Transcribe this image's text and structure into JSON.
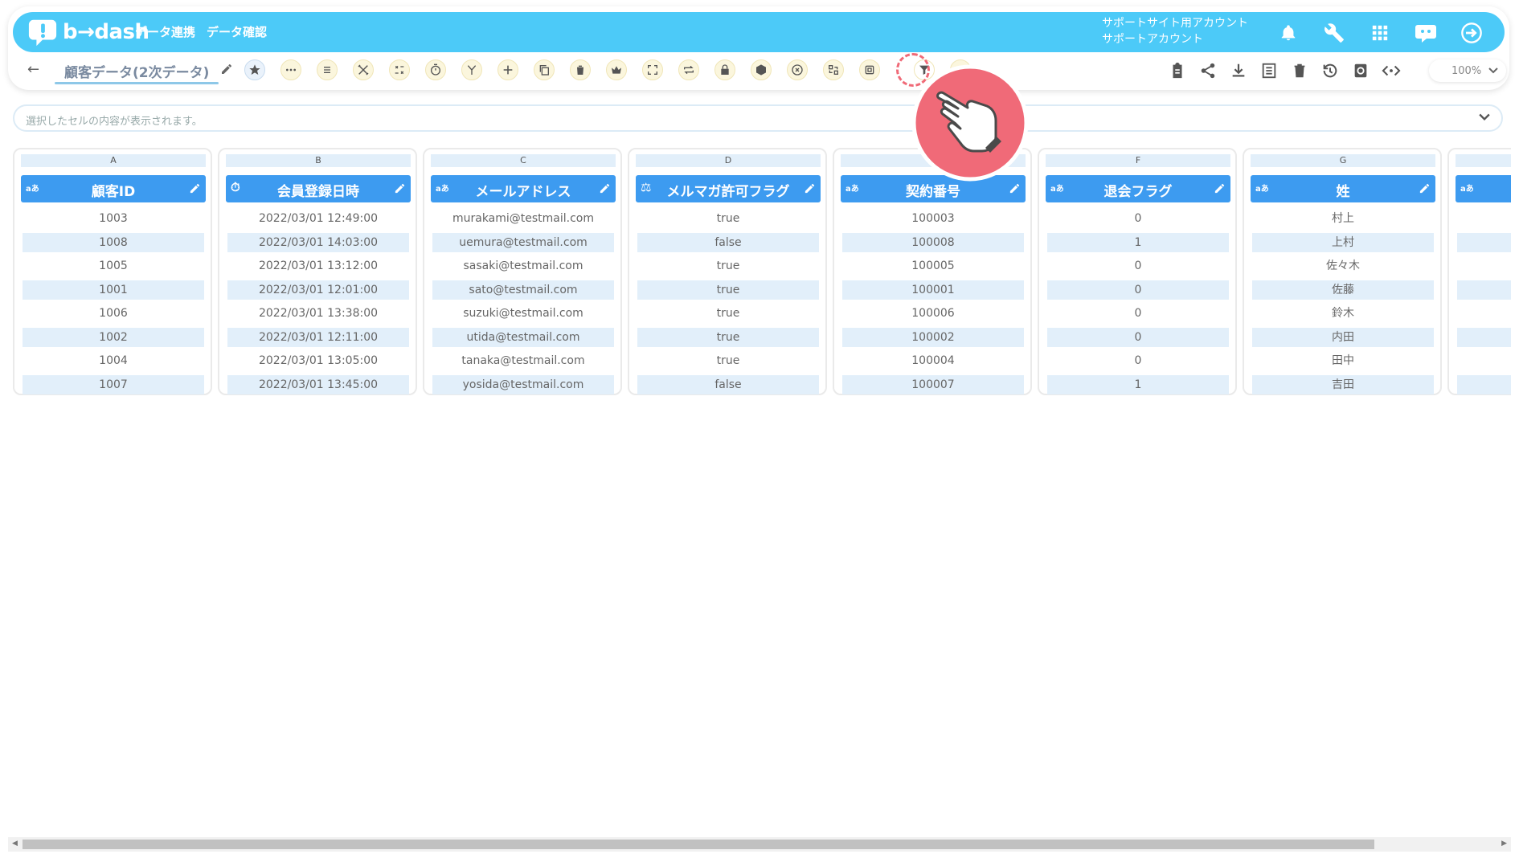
{
  "app": {
    "brand": "b→dash",
    "colors": {
      "nav": "#4ccaf8",
      "header": "#3d9bf0",
      "alt_row": "#e2effa",
      "accent": "#f06a78"
    }
  },
  "nav": {
    "links": [
      "データ連携",
      "データ確認"
    ],
    "account_line1": "サポートサイト用アカウント",
    "account_line2": "サポートアカウント",
    "icons": [
      "bell-icon",
      "wrench-icon",
      "apps-grid-icon",
      "support-chat-icon",
      "logout-icon"
    ]
  },
  "toolbar": {
    "title": "顧客データ(2次データ)",
    "zoom": "100%",
    "tool_icons": [
      "star-icon",
      "more-icon",
      "list-icon",
      "tools-icon",
      "transform-icon",
      "timer-icon",
      "branch-icon",
      "add-icon",
      "copy-icon",
      "delete-icon",
      "crown-icon",
      "expand-icon",
      "repeat-icon",
      "lock-icon",
      "package-icon",
      "close-circle-icon",
      "swap-icon",
      "frame-icon",
      "filter-icon",
      "more-tools-icon"
    ],
    "right_icons": [
      "clipboard-icon",
      "share-icon",
      "download-icon",
      "sheet-icon",
      "trash-icon",
      "history-icon",
      "refresh-icon",
      "code-icon"
    ]
  },
  "formula_bar": {
    "placeholder": "選択したセルの内容が表示されます。"
  },
  "table": {
    "columns": [
      {
        "letter": "A",
        "type": "aあ",
        "name": "顧客ID",
        "rows": [
          "1003",
          "1008",
          "1005",
          "1001",
          "1006",
          "1002",
          "1004",
          "1007"
        ]
      },
      {
        "letter": "B",
        "type": "⏱",
        "name": "会員登録日時",
        "rows": [
          "2022/03/01 12:49:00",
          "2022/03/01 14:03:00",
          "2022/03/01 13:12:00",
          "2022/03/01 12:01:00",
          "2022/03/01 13:38:00",
          "2022/03/01 12:11:00",
          "2022/03/01 13:05:00",
          "2022/03/01 13:45:00"
        ]
      },
      {
        "letter": "C",
        "type": "aあ",
        "name": "メールアドレス",
        "rows": [
          "murakami@testmail.com",
          "uemura@testmail.com",
          "sasaki@testmail.com",
          "sato@testmail.com",
          "suzuki@testmail.com",
          "utida@testmail.com",
          "tanaka@testmail.com",
          "yosida@testmail.com"
        ]
      },
      {
        "letter": "D",
        "type": "⚖",
        "name": "メルマガ許可フラグ",
        "rows": [
          "true",
          "false",
          "true",
          "true",
          "true",
          "true",
          "true",
          "false"
        ]
      },
      {
        "letter": "",
        "type": "aあ",
        "name": "契約番号",
        "rows": [
          "100003",
          "100008",
          "100005",
          "100001",
          "100006",
          "100002",
          "100004",
          "100007"
        ]
      },
      {
        "letter": "F",
        "type": "aあ",
        "name": "退会フラグ",
        "rows": [
          "0",
          "1",
          "0",
          "0",
          "0",
          "0",
          "0",
          "1"
        ]
      },
      {
        "letter": "G",
        "type": "aあ",
        "name": "姓",
        "rows": [
          "村上",
          "上村",
          "佐々木",
          "佐藤",
          "鈴木",
          "内田",
          "田中",
          "吉田"
        ]
      },
      {
        "letter": "",
        "type": "aあ",
        "name": "",
        "rows": [
          "",
          "",
          "",
          "",
          "",
          "",
          "",
          ""
        ]
      }
    ]
  }
}
